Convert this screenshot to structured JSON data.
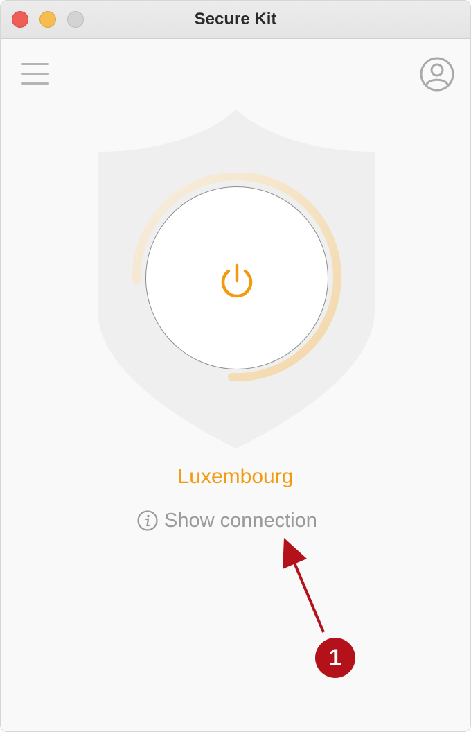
{
  "window": {
    "title": "Secure Kit"
  },
  "toolbar": {
    "menu_icon": "hamburger-menu-icon",
    "account_icon": "user-account-icon"
  },
  "vpn": {
    "power_icon": "power-icon",
    "status_colors": {
      "accent": "#f29b11",
      "ring": "#f5ddb5",
      "shield": "#efefef"
    },
    "location": "Luxembourg",
    "show_connection_label": "Show connection",
    "info_icon": "info-icon"
  },
  "annotation": {
    "badge_number": "1",
    "color": "#b3121a"
  }
}
